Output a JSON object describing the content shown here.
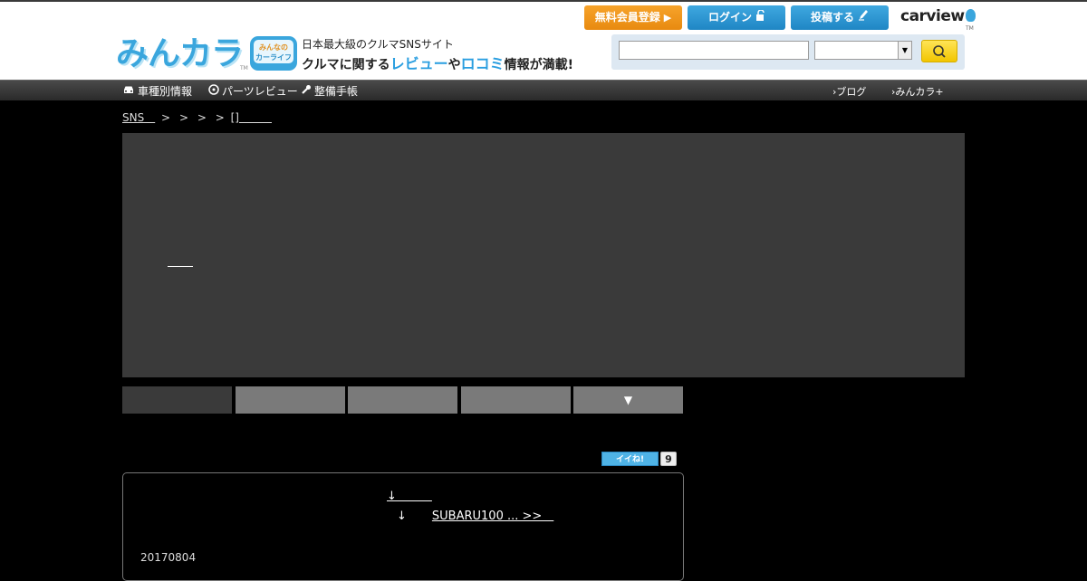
{
  "header": {
    "logo_text": "みんカラ",
    "logo_tm": "TM",
    "carlife_top": "みんなの",
    "carlife_bottom": "カーライフ",
    "tagline_line1": "日本最大級のクルマSNSサイト",
    "tagline_pre": "クルマに関する",
    "tagline_review": "レビュー",
    "tagline_mid": "や",
    "tagline_kuchikomi": "ロコミ",
    "tagline_post": "情報が満載!",
    "register_label": "無料会員登録",
    "login_label": "ログイン",
    "post_label": "投稿する",
    "carview_label": "carview",
    "carview_tm": "TM"
  },
  "search": {
    "input_value": "",
    "select_value": ""
  },
  "nav": {
    "items": [
      {
        "label": "車種別情報"
      },
      {
        "label": "パーツレビュー"
      },
      {
        "label": "整備手帳"
      }
    ],
    "right": [
      {
        "label": "ブログ"
      },
      {
        "label": "みんカラ+"
      }
    ]
  },
  "breadcrumb": {
    "first": "SNS　",
    "seps": [
      ">",
      ">",
      ">",
      ">"
    ],
    "last": "[]　　　"
  },
  "tabs": {
    "more_label": "▼"
  },
  "like": {
    "label": "イイね!",
    "count": "9"
  },
  "content": {
    "line1": "↓　　　",
    "line2_arrow": "↓",
    "line2_link": "SUBARU100 ... >>　",
    "date": "20170804"
  },
  "colors": {
    "accent_blue": "#3aa6dd",
    "orange": "#f29a1f",
    "yellow": "#f2c600"
  }
}
